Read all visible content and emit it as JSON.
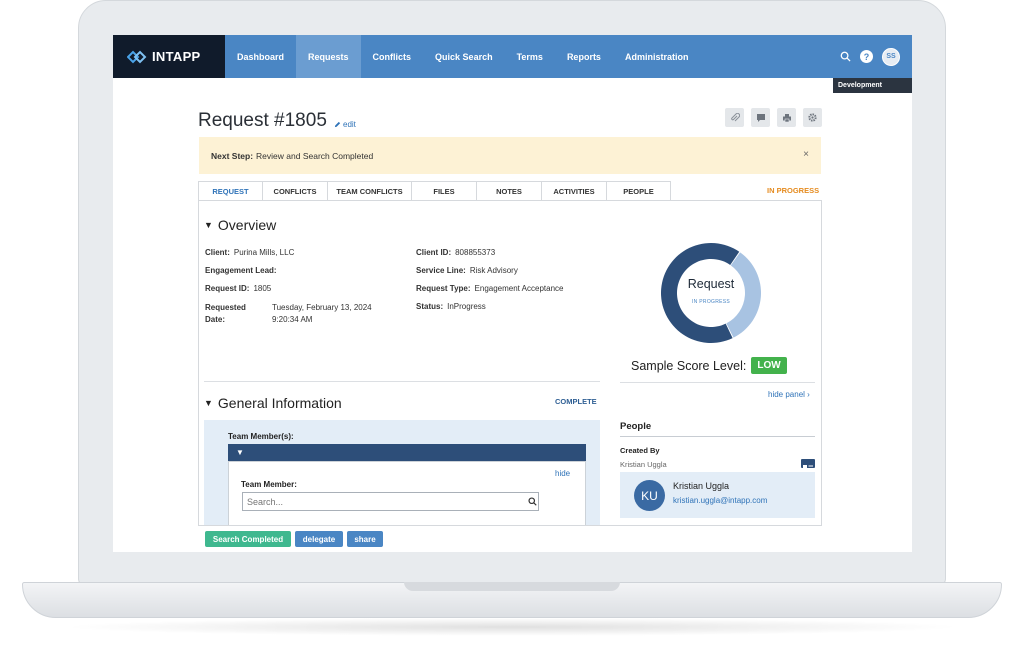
{
  "brand": {
    "name": "INTAPP"
  },
  "nav": {
    "items": [
      {
        "label": "Dashboard"
      },
      {
        "label": "Requests"
      },
      {
        "label": "Conflicts"
      },
      {
        "label": "Quick Search"
      },
      {
        "label": "Terms"
      },
      {
        "label": "Reports"
      },
      {
        "label": "Administration"
      }
    ],
    "active": "Requests",
    "help": "?",
    "user_initials": "SS",
    "environment": "Development"
  },
  "header": {
    "title": "Request #1805",
    "edit_label": "edit"
  },
  "next_step": {
    "prefix": "Next Step:",
    "text": "Review and Search Completed",
    "close": "×"
  },
  "tabs": [
    {
      "label": "REQUEST"
    },
    {
      "label": "CONFLICTS"
    },
    {
      "label": "TEAM CONFLICTS"
    },
    {
      "label": "FILES"
    },
    {
      "label": "NOTES"
    },
    {
      "label": "ACTIVITIES"
    },
    {
      "label": "PEOPLE"
    }
  ],
  "status": "IN PROGRESS",
  "overview": {
    "title": "Overview",
    "client": {
      "label": "Client:",
      "value": "Purina Mills, LLC"
    },
    "engagement_lead": {
      "label": "Engagement Lead:",
      "value": ""
    },
    "request_id": {
      "label": "Request ID:",
      "value": "1805"
    },
    "requested_date": {
      "label_line1": "Requested",
      "label_line2": "Date:",
      "value_line1": "Tuesday, February 13, 2024",
      "value_line2": "9:20:34 AM"
    },
    "client_id": {
      "label": "Client ID:",
      "value": "808855373"
    },
    "service_line": {
      "label": "Service Line:",
      "value": "Risk Advisory"
    },
    "request_type": {
      "label": "Request Type:",
      "value": "Engagement Acceptance"
    },
    "status_field": {
      "label": "Status:",
      "value": "InProgress"
    }
  },
  "donut": {
    "title": "Request",
    "subtitle": "IN PROGRESS",
    "segments": [
      {
        "value": 0.33,
        "color": "#a8c3e2"
      },
      {
        "value": 0.67,
        "color": "#2d4e79"
      }
    ]
  },
  "score": {
    "label": "Sample Score Level:",
    "value": "LOW"
  },
  "hide_panel": "hide panel ›",
  "general": {
    "title": "General Information",
    "complete": "COMPLETE",
    "team_members_label": "Team Member(s):",
    "hide": "hide",
    "team_member_label": "Team Member:",
    "search_placeholder": "Search..."
  },
  "people": {
    "title": "People",
    "created_by_label": "Created By",
    "created_by_name": "Kristian Uggla",
    "person": {
      "initials": "KU",
      "name": "Kristian Uggla",
      "email": "kristian.uggla@intapp.com"
    }
  },
  "actions": {
    "search_completed": "Search Completed",
    "delegate": "delegate",
    "share": "share"
  }
}
